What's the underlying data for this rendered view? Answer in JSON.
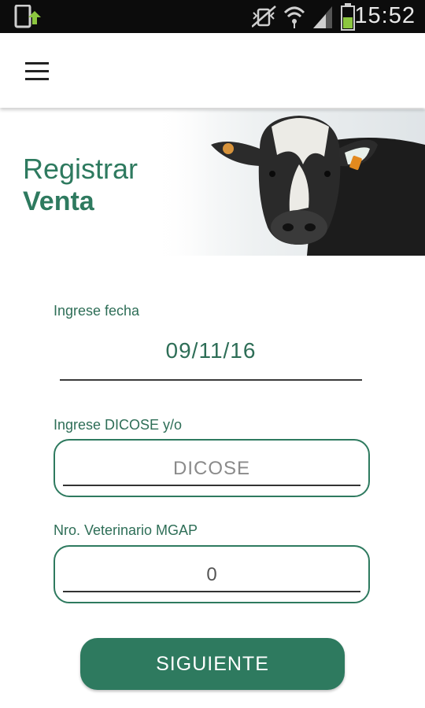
{
  "status_bar": {
    "time": "15:52",
    "icons": [
      "device-download-icon",
      "mute-vibrate-icon",
      "wifi-icon",
      "signal-icon",
      "battery-icon"
    ]
  },
  "app_bar": {
    "menu_icon": "hamburger-menu-icon"
  },
  "hero": {
    "title_line1": "Registrar",
    "title_line2": "Venta",
    "image": "cow-photo"
  },
  "form": {
    "date_label": "Ingrese fecha",
    "date_value": "09/11/16",
    "dicose_label": "Ingrese DICOSE y/o",
    "dicose_placeholder": "DICOSE",
    "vet_label": "Nro. Veterinario MGAP",
    "vet_value": "0",
    "submit_label": "SIGUIENTE"
  },
  "colors": {
    "accent": "#2e7a5f",
    "status_bar": "#0c0c0c"
  }
}
